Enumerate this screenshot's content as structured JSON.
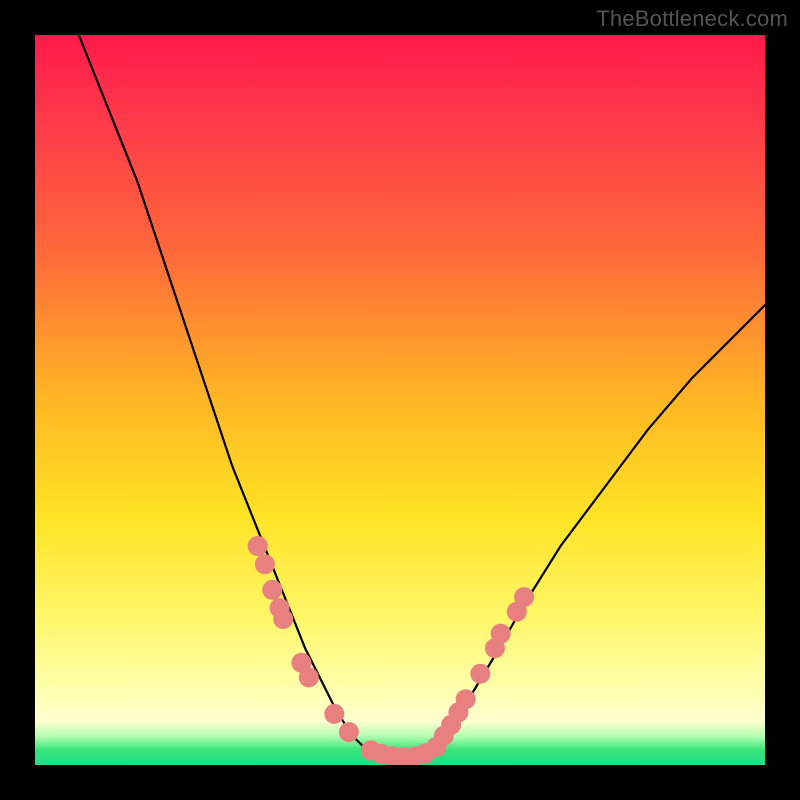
{
  "attribution": "TheBottleneck.com",
  "chart_data": {
    "type": "line",
    "title": "",
    "xlabel": "",
    "ylabel": "",
    "xlim": [
      0,
      100
    ],
    "ylim": [
      0,
      100
    ],
    "series": [
      {
        "name": "curve-left",
        "x": [
          6,
          10,
          14,
          18,
          22,
          25,
          27,
          29,
          31,
          33,
          35,
          37,
          39,
          41,
          42.5,
          44,
          45.5
        ],
        "y": [
          100,
          90,
          80,
          68,
          56,
          47,
          41,
          36,
          31,
          26,
          21,
          16,
          12,
          8,
          5.5,
          3.5,
          2
        ]
      },
      {
        "name": "curve-bottom",
        "x": [
          45.5,
          47,
          49,
          51,
          53,
          54.5
        ],
        "y": [
          2,
          1.2,
          1,
          1,
          1.2,
          2
        ]
      },
      {
        "name": "curve-right",
        "x": [
          54.5,
          56,
          58,
          60,
          63,
          67,
          72,
          78,
          84,
          90,
          96,
          100
        ],
        "y": [
          2,
          4,
          7,
          10,
          15,
          22,
          30,
          38,
          46,
          53,
          59,
          63
        ]
      }
    ],
    "dots": {
      "name": "data-points",
      "color": "#e98080",
      "radius_px": 10,
      "points": [
        [
          30.5,
          30
        ],
        [
          31.5,
          27.5
        ],
        [
          32.5,
          24
        ],
        [
          33.5,
          21.5
        ],
        [
          34,
          20
        ],
        [
          36.5,
          14
        ],
        [
          37.5,
          12
        ],
        [
          41,
          7
        ],
        [
          43,
          4.5
        ],
        [
          46,
          2
        ],
        [
          47.5,
          1.5
        ],
        [
          49,
          1.2
        ],
        [
          50.5,
          1.1
        ],
        [
          52,
          1.2
        ],
        [
          53.5,
          1.6
        ],
        [
          55,
          2.5
        ],
        [
          56,
          4
        ],
        [
          57,
          5.5
        ],
        [
          58,
          7.2
        ],
        [
          59,
          9
        ],
        [
          61,
          12.5
        ],
        [
          63,
          16
        ],
        [
          63.8,
          18
        ],
        [
          66,
          21
        ],
        [
          67,
          23
        ]
      ]
    }
  }
}
